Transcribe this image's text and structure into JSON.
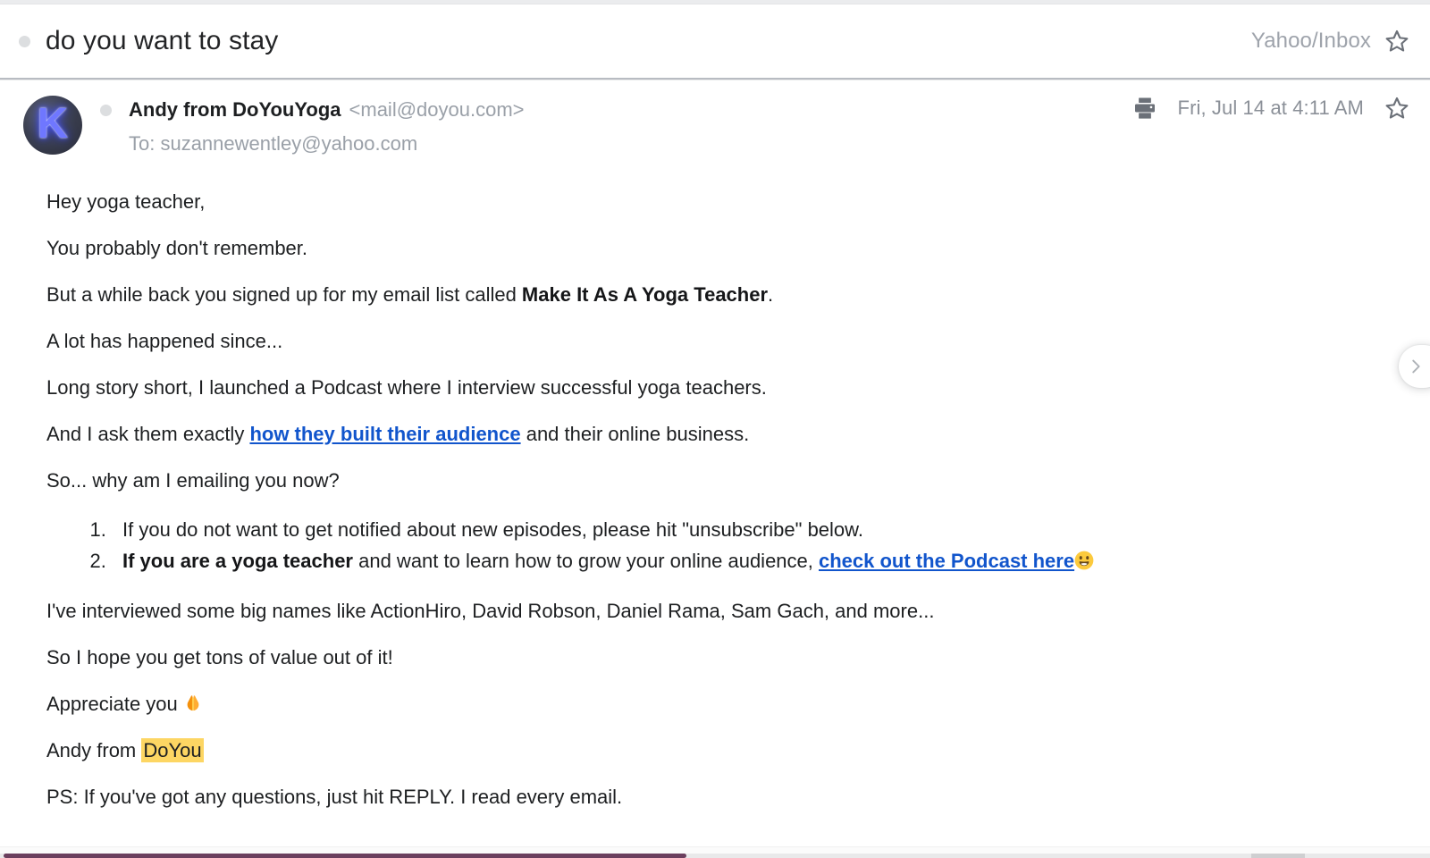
{
  "window": {
    "app": "email-client-message-view"
  },
  "header": {
    "unread_indicator": "unread-dot",
    "subject": "do you want to stay",
    "folder": "Yahoo/Inbox",
    "star_icon": "star-outline-icon"
  },
  "message": {
    "avatar_letter": "K",
    "avatar_name": "avatar",
    "sender_name": "Andy from DoYouYoga",
    "sender_email": "<mail@doyou.com>",
    "recipient": "To: suzannewentley@yahoo.com",
    "print_icon": "printer-icon",
    "date": "Fri, Jul 14 at 4:11 AM",
    "star_icon": "star-outline-icon"
  },
  "body": {
    "greeting": "Hey yoga teacher,",
    "p_remember": "You probably don't remember.",
    "p_signup_pre": "But a while back you signed up for my email list called ",
    "p_signup_bold": "Make It As A Yoga Teacher",
    "p_signup_post": ".",
    "p_alot": "A lot has happened since...",
    "p_podcast": "Long story short, I launched a Podcast where I interview successful yoga teachers.",
    "p_ask_pre": "And I ask them exactly ",
    "p_ask_link": "how they built their audience",
    "p_ask_post": " and their online business.",
    "p_why": "So... why am I emailing you now?",
    "list": {
      "item1": "If you do not want to get notified about new episodes, please hit \"unsubscribe\" below.",
      "item2_bold": "If you are a yoga teacher",
      "item2_mid": " and want to learn how to grow your online audience, ",
      "item2_link": "check out the Podcast here",
      "item2_emoji": "grinning-face-emoji"
    },
    "p_names": "I've interviewed some big names like ActionHiro, David Robson, Daniel Rama, Sam Gach, and more...",
    "p_hope": "So I hope you get tons of value out of it!",
    "p_appreciate": "Appreciate you ",
    "p_appreciate_emoji": "folded-hands-emoji",
    "p_sign_pre": "Andy from ",
    "p_sign_highlight": "DoYou",
    "p_ps": "PS: If you've got any questions, just hit REPLY. I read every email."
  },
  "controls": {
    "next_message": "chevron-right-icon"
  },
  "colors": {
    "link": "#1155cc",
    "highlight": "#fdd663",
    "muted_text": "#9aa0a8",
    "body_text": "#1d1f21"
  }
}
